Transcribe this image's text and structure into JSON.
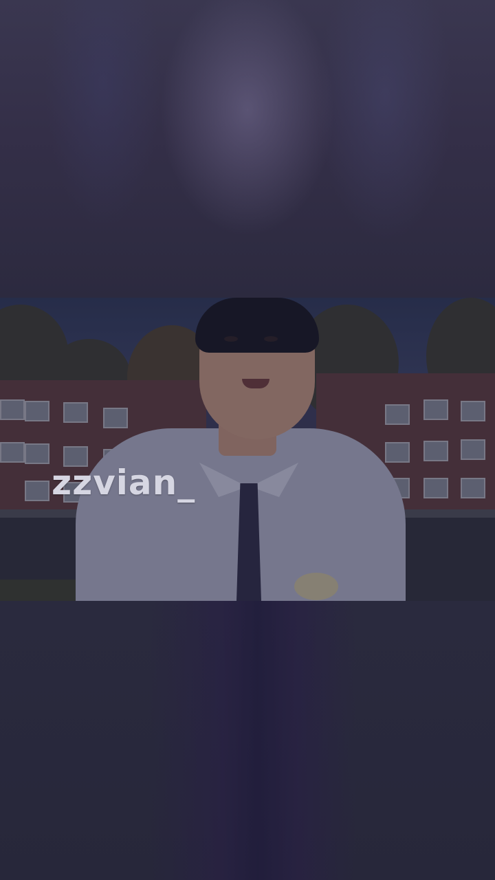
{
  "watermark": {
    "text": "zzvian_"
  },
  "colors": {
    "background": "#262638",
    "watermark": "#d6d6e2"
  }
}
